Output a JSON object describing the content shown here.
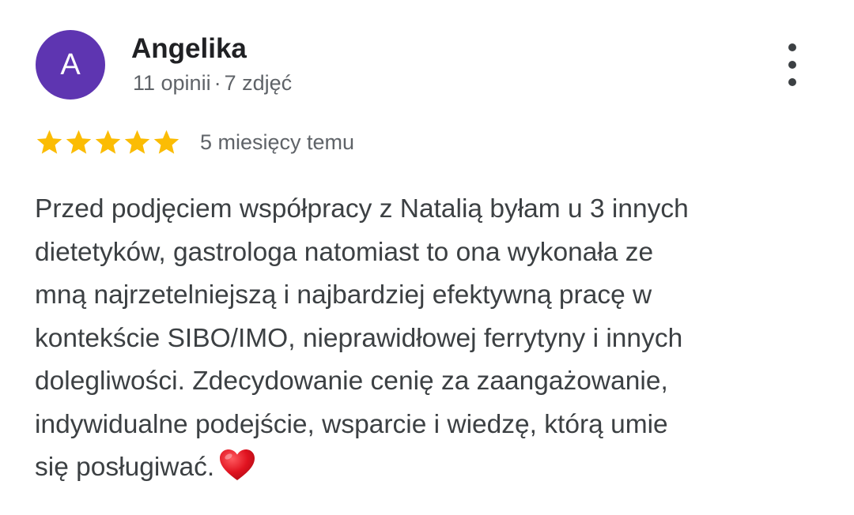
{
  "reviewer": {
    "avatar_letter": "A",
    "avatar_color": "#5e35b1",
    "name": "Angelika",
    "reviews_count": "11 opinii",
    "separator": "·",
    "photos_count": "7 zdjęć"
  },
  "rating": {
    "stars": 5,
    "max_stars": 5,
    "star_color": "#fbbc04",
    "date": "5 miesięcy temu"
  },
  "review": {
    "line_1": "Przed podjęciem współpracy z Natalią byłam u 3 innych",
    "line_2": "dietetyków, gastrologa natomiast to ona wykonała ze",
    "line_3": "mną najrzetelniejszą i najbardziej efektywną pracę w",
    "line_4": "kontekście SIBO/IMO, nieprawidłowej ferrytyny i innych",
    "line_5": "dolegliwości. Zdecydowanie cenię za zaangażowanie,",
    "line_6": "indywidualne podejście, wsparcie i wiedzę, którą umie",
    "line_7": "się posługiwać.",
    "emoji": "heart-emoji"
  },
  "icons": {
    "more": "more-vertical-icon",
    "star": "star-icon"
  }
}
